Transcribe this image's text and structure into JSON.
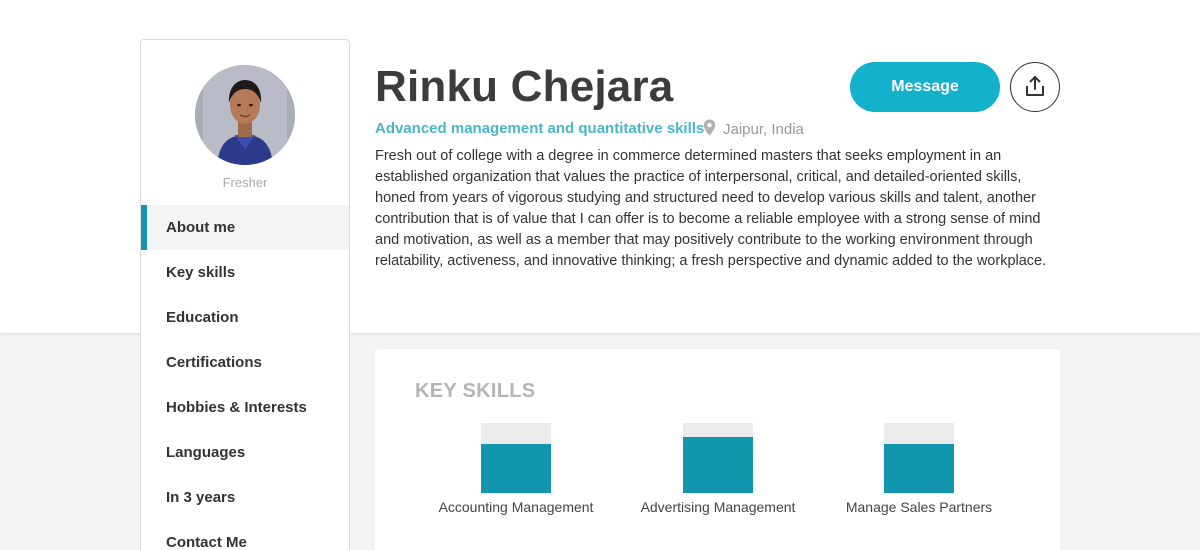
{
  "profile": {
    "name": "Rinku Chejara",
    "level": "Fresher",
    "headline": "Advanced management and quantitative skills",
    "location": "Jaipur, India",
    "bio": "Fresh out of college with a degree in commerce determined masters that seeks employment in an established organization that values the practice of interpersonal, critical, and detailed-oriented skills, honed from years of vigorous studying and structured need to develop various skills and talent, another contribution that is of value that I can offer is to become a reliable employee with a strong sense of mind and motivation, as well as a member that may positively contribute to the working environment through relatability, activeness, and innovative thinking; a fresh perspective and dynamic added to the workplace."
  },
  "actions": {
    "message_label": "Message",
    "share_icon": "share-upload-icon"
  },
  "sidebar": {
    "active_index": 0,
    "items": [
      {
        "label": "About me"
      },
      {
        "label": "Key skills"
      },
      {
        "label": "Education"
      },
      {
        "label": "Certifications"
      },
      {
        "label": "Hobbies & Interests"
      },
      {
        "label": "Languages"
      },
      {
        "label": "In 3 years"
      },
      {
        "label": "Contact Me"
      }
    ]
  },
  "key_skills": {
    "title": "KEY SKILLS",
    "skills": [
      {
        "label": "Accounting Management",
        "level": 0.7
      },
      {
        "label": "Advertising Management",
        "level": 0.8
      },
      {
        "label": "Manage Sales Partners",
        "level": 0.7
      }
    ]
  },
  "colors": {
    "accent": "#13b1cc",
    "bar": "#1296ad",
    "headline": "#4ab6c8"
  }
}
